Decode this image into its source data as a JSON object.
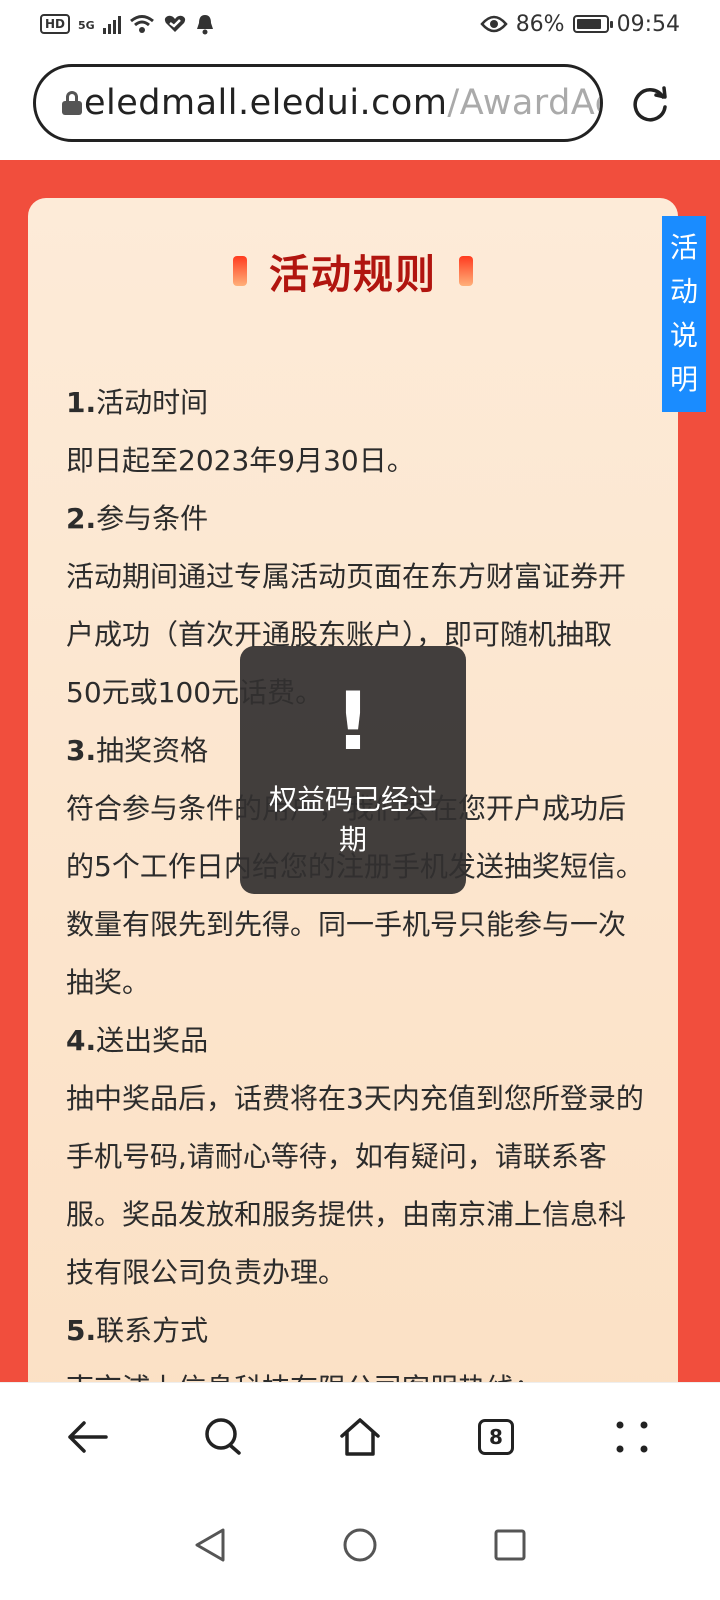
{
  "status_bar": {
    "hd": "HD",
    "network": "5G",
    "battery_percent": "86%",
    "battery_level": 0.86,
    "time": "09:54"
  },
  "url_bar": {
    "url_host": "eledmall.eledui.com",
    "url_path": "/AwardAc"
  },
  "page": {
    "title": "活动规则",
    "side_tab": [
      "活",
      "动",
      "说",
      "明"
    ],
    "rules": [
      {
        "heading_num": "1.",
        "heading": "活动时间",
        "body": "即日起至2023年9月30日。"
      },
      {
        "heading_num": "2.",
        "heading": "参与条件",
        "body": "活动期间通过专属活动页面在东方财富证券开户成功（首次开通股东账户），即可随机抽取50元或100元话费。"
      },
      {
        "heading_num": "3.",
        "heading": "抽奖资格",
        "body": "符合参与条件的用户，我们会在您开户成功后的5个工作日内给您的注册手机发送抽奖短信。数量有限先到先得。同一手机号只能参与一次抽奖。"
      },
      {
        "heading_num": "4.",
        "heading": "送出奖品",
        "body": "抽中奖品后，话费将在3天内充值到您所登录的手机号码,请耐心等待，如有疑问，请联系客服。奖品发放和服务提供，由南京浦上信息科技有限公司负责办理。"
      },
      {
        "heading_num": "5.",
        "heading": "联系方式",
        "body": "南京浦上信息科技有限公司客服热线："
      }
    ]
  },
  "toast": {
    "icon": "!",
    "message": "权益码已经过期"
  },
  "toolbar": {
    "tab_count": "8"
  },
  "colors": {
    "page_red": "#f14e3d",
    "title_red": "#b1150f",
    "side_tab_blue": "#1a8cff"
  }
}
